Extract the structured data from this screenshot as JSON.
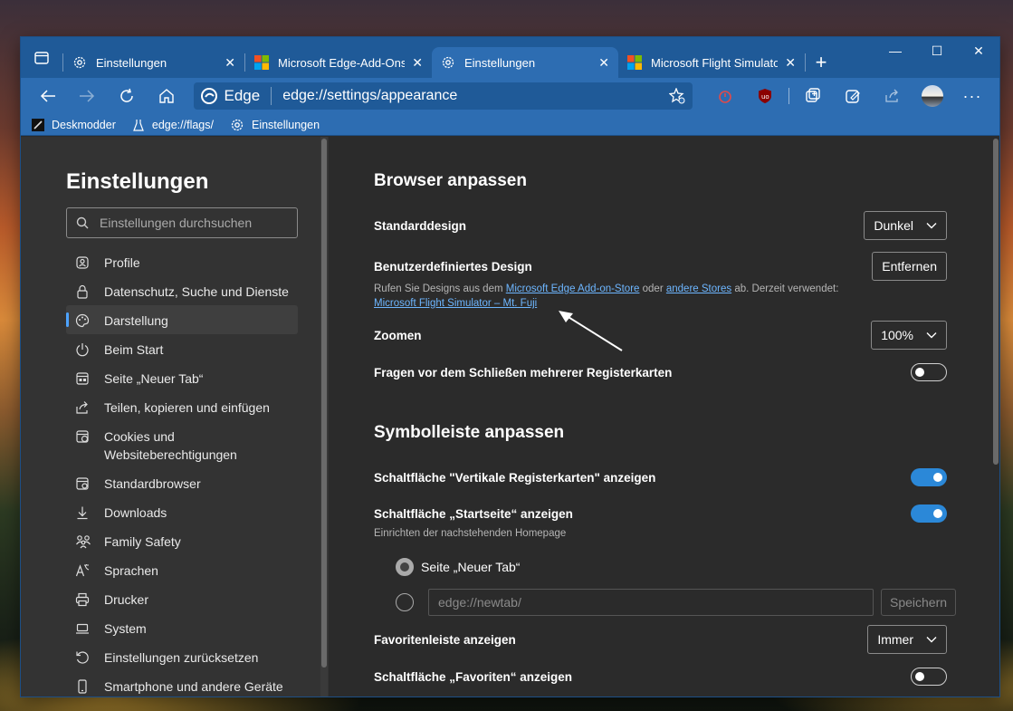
{
  "tabs": [
    {
      "title": "Einstellungen",
      "icon": "gear-icon",
      "active": false
    },
    {
      "title": "Microsoft Edge-Add-Ons -",
      "icon": "microsoft-logo-icon",
      "active": false
    },
    {
      "title": "Einstellungen",
      "icon": "gear-icon",
      "active": true
    },
    {
      "title": "Microsoft Flight Simulator",
      "icon": "microsoft-logo-icon",
      "active": false
    }
  ],
  "address": {
    "brand": "Edge",
    "url": "edge://settings/appearance"
  },
  "favorites": [
    {
      "label": "Deskmodder",
      "icon": "pen-icon"
    },
    {
      "label": "edge://flags/",
      "icon": "flask-icon"
    },
    {
      "label": "Einstellungen",
      "icon": "gear-icon"
    }
  ],
  "sidebar": {
    "title": "Einstellungen",
    "search_placeholder": "Einstellungen durchsuchen",
    "items": [
      {
        "label": "Profile",
        "icon": "profile-icon"
      },
      {
        "label": "Datenschutz, Suche und Dienste",
        "icon": "lock-icon"
      },
      {
        "label": "Darstellung",
        "icon": "palette-icon",
        "active": true
      },
      {
        "label": "Beim Start",
        "icon": "power-icon"
      },
      {
        "label": "Seite „Neuer Tab“",
        "icon": "newtab-icon"
      },
      {
        "label": "Teilen, kopieren und einfügen",
        "icon": "share-icon"
      },
      {
        "label": "Cookies und Websiteberechtigungen",
        "icon": "cookie-icon"
      },
      {
        "label": "Standardbrowser",
        "icon": "browser-icon"
      },
      {
        "label": "Downloads",
        "icon": "download-icon"
      },
      {
        "label": "Family Safety",
        "icon": "family-icon"
      },
      {
        "label": "Sprachen",
        "icon": "language-icon"
      },
      {
        "label": "Drucker",
        "icon": "printer-icon"
      },
      {
        "label": "System",
        "icon": "laptop-icon"
      },
      {
        "label": "Einstellungen zurücksetzen",
        "icon": "reset-icon"
      },
      {
        "label": "Smartphone und andere Geräte",
        "icon": "phone-icon"
      }
    ]
  },
  "main": {
    "section1_title": "Browser anpassen",
    "standarddesign_label": "Standarddesign",
    "standarddesign_value": "Dunkel",
    "custom_design_label": "Benutzerdefiniertes Design",
    "remove_button": "Entfernen",
    "custom_desc_1": "Rufen Sie Designs aus dem",
    "custom_link_store": "Microsoft Edge Add-on-Store",
    "custom_desc_2": "oder",
    "custom_link_other": "andere Stores",
    "custom_desc_3": "ab. Derzeit verwendet:",
    "current_theme": "Microsoft Flight Simulator – Mt. Fuji",
    "zoom_label": "Zoomen",
    "zoom_value": "100%",
    "close_tabs_label": "Fragen vor dem Schließen mehrerer Registerkarten",
    "section2_title": "Symbolleiste anpassen",
    "vertical_tabs_label": "Schaltfläche \"Vertikale Registerkarten\" anzeigen",
    "home_button_label": "Schaltfläche „Startseite“ anzeigen",
    "home_desc": "Einrichten der nachstehenden Homepage",
    "radio_newtab": "Seite „Neuer Tab“",
    "url_placeholder": "edge://newtab/",
    "save_button": "Speichern",
    "favbar_label": "Favoritenleiste anzeigen",
    "favbar_value": "Immer",
    "favorites_button_label": "Schaltfläche „Favoriten“ anzeigen"
  },
  "toggles": {
    "close_tabs": false,
    "vertical_tabs": true,
    "home_button": true,
    "favorites_button": false
  },
  "colors": {
    "accent": "#2d6db2",
    "tabstrip": "#1f5a98",
    "toggle_on": "#2b88d8",
    "link": "#6db6ff"
  }
}
